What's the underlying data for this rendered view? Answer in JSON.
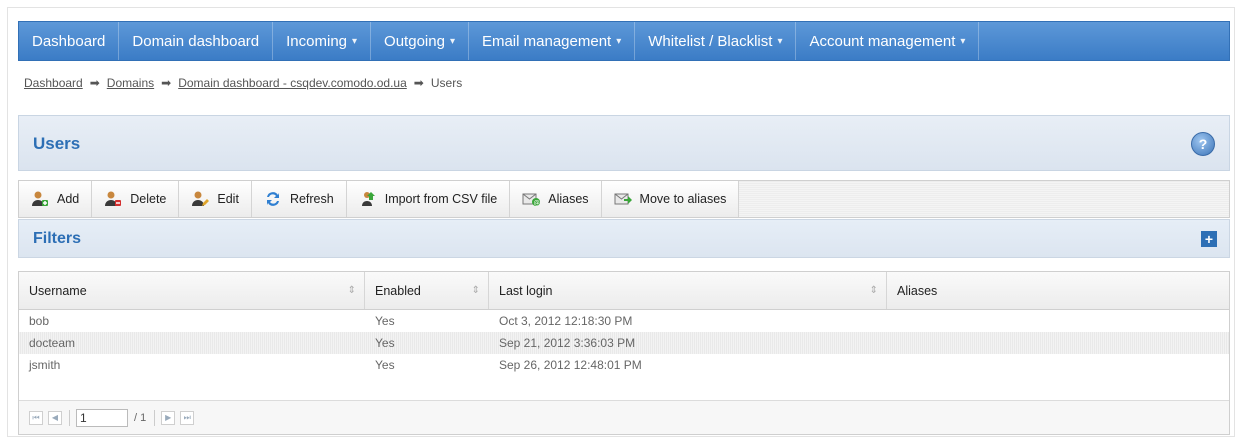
{
  "nav": {
    "items": [
      {
        "label": "Dashboard",
        "dropdown": false
      },
      {
        "label": "Domain dashboard",
        "dropdown": false
      },
      {
        "label": "Incoming",
        "dropdown": true
      },
      {
        "label": "Outgoing",
        "dropdown": true
      },
      {
        "label": "Email management",
        "dropdown": true
      },
      {
        "label": "Whitelist / Blacklist",
        "dropdown": true
      },
      {
        "label": "Account management",
        "dropdown": true
      }
    ]
  },
  "breadcrumb": {
    "items": [
      "Dashboard",
      "Domains",
      "Domain dashboard - csqdev.comodo.od.ua"
    ],
    "current": "Users"
  },
  "page": {
    "title": "Users",
    "help_icon": "?"
  },
  "toolbar": {
    "buttons": [
      {
        "label": "Add",
        "icon": "user-add-icon"
      },
      {
        "label": "Delete",
        "icon": "user-delete-icon"
      },
      {
        "label": "Edit",
        "icon": "user-edit-icon"
      },
      {
        "label": "Refresh",
        "icon": "refresh-icon"
      },
      {
        "label": "Import from CSV file",
        "icon": "import-icon"
      },
      {
        "label": "Aliases",
        "icon": "aliases-icon"
      },
      {
        "label": "Move to aliases",
        "icon": "move-to-aliases-icon"
      }
    ]
  },
  "filters": {
    "title": "Filters",
    "expand_icon": "+"
  },
  "table": {
    "columns": [
      "Username",
      "Enabled",
      "Last login",
      "Aliases"
    ],
    "rows": [
      {
        "username": "bob",
        "enabled": "Yes",
        "last_login": "Oct 3, 2012 12:18:30 PM",
        "aliases": ""
      },
      {
        "username": "docteam",
        "enabled": "Yes",
        "last_login": "Sep 21, 2012 3:36:03 PM",
        "aliases": ""
      },
      {
        "username": "jsmith",
        "enabled": "Yes",
        "last_login": "Sep 26, 2012 12:48:01 PM",
        "aliases": ""
      }
    ]
  },
  "pager": {
    "page": "1",
    "of": "/ 1"
  },
  "colors": {
    "nav_bg": "#3b7cc6",
    "title_blue": "#2d6fb5"
  }
}
